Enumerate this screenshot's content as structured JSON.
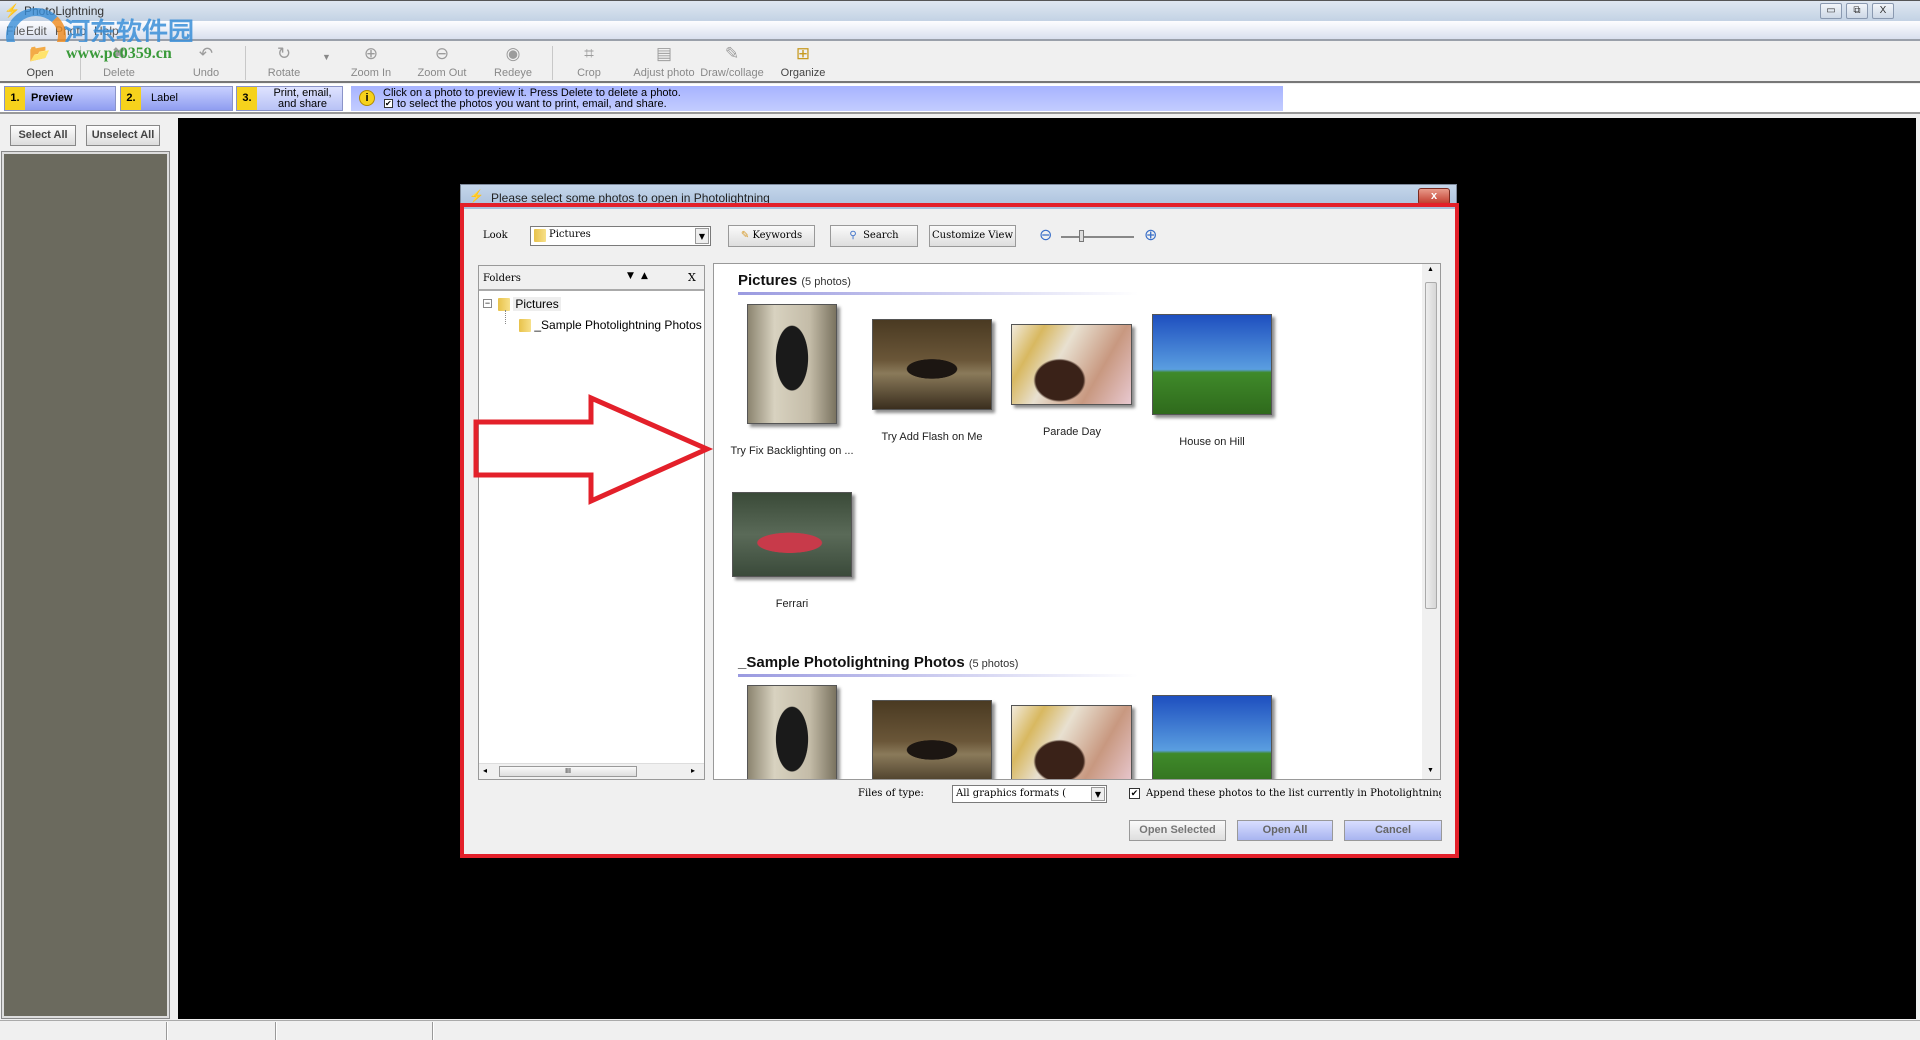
{
  "app": {
    "title": "PhotoLightning",
    "watermark": "河东软件园 www.pc0359.cn"
  },
  "window_controls": {
    "minimize": "▭",
    "restore": "⧉",
    "close": "X"
  },
  "menu": [
    "File",
    "Edit",
    "Photo",
    "Help"
  ],
  "toolbar": [
    {
      "label": "Open",
      "icon": "open-folder-icon",
      "glyph": "📂",
      "enabled": true
    },
    {
      "label": "Delete",
      "icon": "delete-icon",
      "glyph": "✖",
      "enabled": false
    },
    {
      "label": "Undo",
      "icon": "undo-icon",
      "glyph": "↶",
      "enabled": false
    },
    {
      "label": "Rotate",
      "icon": "rotate-icon",
      "glyph": "↻",
      "enabled": false
    },
    {
      "label": "Zoom In",
      "icon": "zoom-in-icon",
      "glyph": "⊕",
      "enabled": false
    },
    {
      "label": "Zoom Out",
      "icon": "zoom-out-icon",
      "glyph": "⊖",
      "enabled": false
    },
    {
      "label": "Redeye",
      "icon": "eye-icon",
      "glyph": "◉",
      "enabled": false
    },
    {
      "label": "Crop",
      "icon": "crop-icon",
      "glyph": "⌗",
      "enabled": false
    },
    {
      "label": "Adjust photo",
      "icon": "adjust-photo-icon",
      "glyph": "▤",
      "enabled": false
    },
    {
      "label": "Draw/collage",
      "icon": "draw-collage-icon",
      "glyph": "✎",
      "enabled": false
    },
    {
      "label": "Organize",
      "icon": "organize-icon",
      "glyph": "⊞",
      "enabled": true
    }
  ],
  "steps": [
    {
      "num": "1.",
      "label": "Preview",
      "active": true
    },
    {
      "num": "2.",
      "label": "Label"
    },
    {
      "num": "3.",
      "label": "Print, email, and share"
    }
  ],
  "info": {
    "line1": "Click on a photo to preview it.  Press Delete to delete a photo.",
    "line2": "to select the photos you want to print, email, and share.",
    "checked": true
  },
  "left": {
    "select_all": "Select All",
    "unselect_all": "Unselect All"
  },
  "dialog": {
    "title": "Please select some photos to open in Photolightning",
    "look_label": "Look",
    "look_value": "Pictures",
    "keywords": "Keywords",
    "search": "Search",
    "customize": "Customize View",
    "folders": {
      "header": "Folders",
      "close": "X",
      "tree": [
        {
          "label": "Pictures",
          "expanded": true
        },
        {
          "label": "_Sample Photolightning Photos"
        }
      ],
      "scroll_thumb": "III"
    },
    "sections": [
      {
        "title": "Pictures",
        "count": "(5 photos)",
        "photos": [
          "Try Fix Backlighting on ...",
          "Try Add Flash on Me",
          "Parade Day",
          "House on Hill",
          "Ferrari"
        ]
      },
      {
        "title": "_Sample Photolightning Photos",
        "count": "(5 photos)"
      }
    ],
    "files_of_type_label": "Files of type:",
    "files_of_type_value": "All graphics formats (",
    "append_label": "Append these photos to the list currently in Photolightning",
    "append_checked": true,
    "open_selected": "Open Selected",
    "open_all": "Open All",
    "cancel": "Cancel"
  },
  "colors": {
    "annotation_red": "#e3202a",
    "step_yellow": "#f6d21c",
    "info_blue": "#a7b3ff",
    "strip_bg": "#6b6a5e"
  }
}
